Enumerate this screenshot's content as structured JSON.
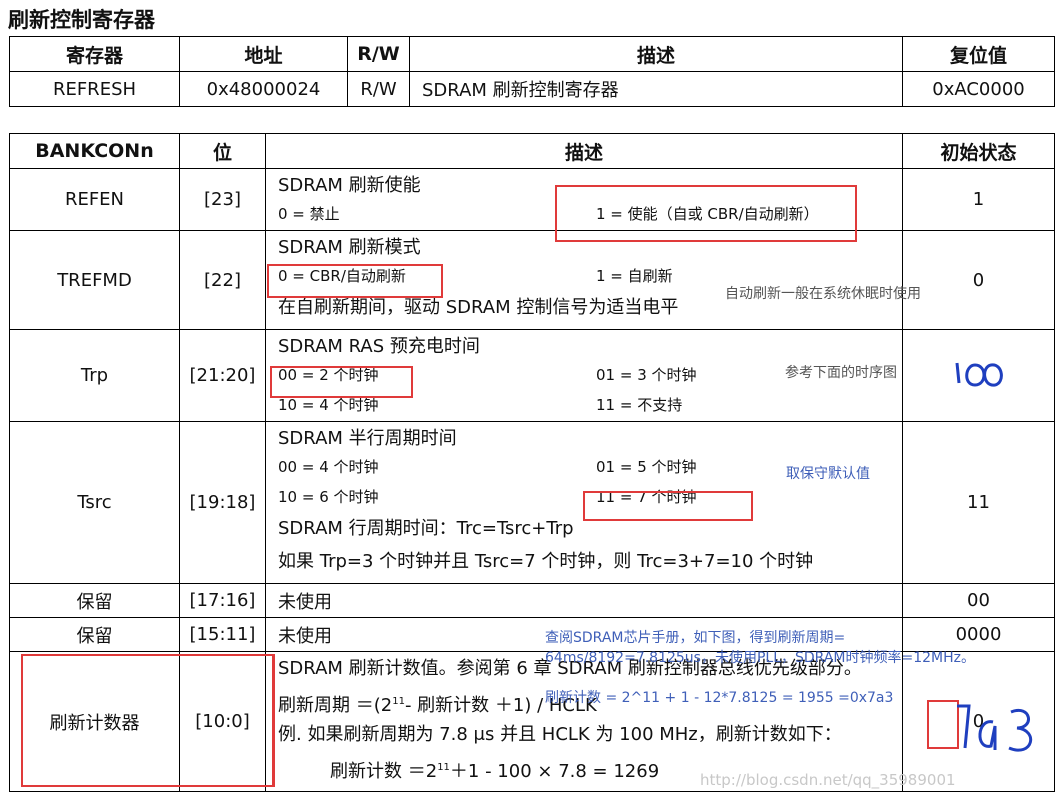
{
  "page_title": "刷新控制寄存器",
  "reg_table": {
    "headers": [
      "寄存器",
      "地址",
      "R/W",
      "描述",
      "复位值"
    ],
    "row": [
      "REFRESH",
      "0x48000024",
      "R/W",
      "SDRAM 刷新控制寄存器",
      "0xAC0000"
    ]
  },
  "bit_table": {
    "headers": [
      "BANKCONn",
      "位",
      "描述",
      "初始状态"
    ],
    "rows": [
      {
        "name": "REFEN",
        "bits": "[23]",
        "init": "1",
        "title": "SDRAM 刷新使能",
        "opt1": "0 = 禁止",
        "opt2": "1 = 使能（自或 CBR/自动刷新）"
      },
      {
        "name": "TREFMD",
        "bits": "[22]",
        "init": "0",
        "title": "SDRAM 刷新模式",
        "opt1": "0 = CBR/自动刷新",
        "opt2": "1 = 自刷新",
        "extra": "在自刷新期间，驱动 SDRAM 控制信号为适当电平"
      },
      {
        "name": "Trp",
        "bits": "[21:20]",
        "init": "10",
        "title": "SDRAM RAS 预充电时间",
        "opt1": "00 = 2 个时钟",
        "opt2": "01 = 3 个时钟",
        "opt3": "10 = 4 个时钟",
        "opt4": "11 = 不支持"
      },
      {
        "name": "Tsrc",
        "bits": "[19:18]",
        "init": "11",
        "title": "SDRAM 半行周期时间",
        "opt1": "00 = 4 个时钟",
        "opt2": "01 = 5 个时钟",
        "opt3": "10 = 6 个时钟",
        "opt4": "11 = 7 个时钟",
        "extra1": "SDRAM 行周期时间：Trc=Tsrc+Trp",
        "extra2": "如果 Trp=3 个时钟并且 Tsrc=7 个时钟，则 Trc=3+7=10 个时钟"
      },
      {
        "name": "保留",
        "bits": "[17:16]",
        "init": "00",
        "desc": "未使用"
      },
      {
        "name": "保留",
        "bits": "[15:11]",
        "init": "0000",
        "desc": "未使用"
      },
      {
        "name": "刷新计数器",
        "bits": "[10:0]",
        "init": "0",
        "line1": "SDRAM 刷新计数值。参阅第 6 章 SDRAM 刷新控制器总线优先级部分。",
        "line2_a": "刷新周期 ＝(2",
        "line2_sup": "11",
        "line2_b": "- 刷新计数 ＋1) / HCLK",
        "line3": "例. 如果刷新周期为 7.8 μs 并且 HCLK 为 100 MHz，刷新计数如下：",
        "line4_a": "刷新计数 ＝2",
        "line4_sup": "11",
        "line4_b": "＋1 - 100 × 7.8 = 1269"
      }
    ]
  },
  "annotations": {
    "note_trefmd": "自动刷新一般在系统休眠时使用",
    "note_trp": "参考下面的时序图",
    "note_tsrc": "取保守默认值",
    "note_counter1": "查阅SDRAM芯片手册，如下图，得到刷新周期=",
    "note_counter2": "64ms/8192=7.8125us，未使用PLL，SDRAM时钟频率=12MHz。",
    "note_counter3": "刷新计数 = 2^11 + 1 - 12*7.8125 = 1955 =0x7a3",
    "hand_trp": "10",
    "hand_counter": "7a3"
  },
  "watermark": "http://blog.csdn.net/qq_35989001"
}
